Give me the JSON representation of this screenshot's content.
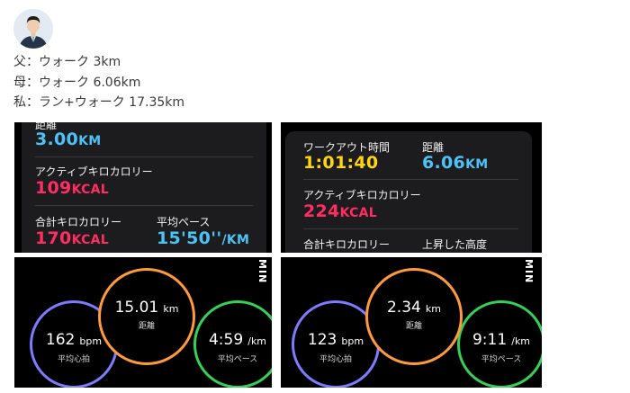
{
  "post": {
    "lines": [
      "父：ウォーク 3km",
      "母：ウォーク 6.06km",
      "私：ラン+ウォーク 17.35km"
    ]
  },
  "panel1": {
    "distance_label": "距離",
    "distance_value": "3.00",
    "distance_unit": "KM",
    "active_cal_label": "アクティブキロカロリー",
    "active_cal_value": "109",
    "active_cal_unit": "KCAL",
    "total_cal_label": "合計キロカロリー",
    "total_cal_value": "170",
    "total_cal_unit": "KCAL",
    "pace_label": "平均ペース",
    "pace_value": "15'50''",
    "pace_unit": "/KM"
  },
  "panel2": {
    "workout_time_label": "ワークアウト時間",
    "workout_time_value": "1:01:40",
    "distance_label": "距離",
    "distance_value": "6.06",
    "distance_unit": "KM",
    "active_cal_label": "アクティブキロカロリー",
    "active_cal_value": "224",
    "active_cal_unit": "KCAL",
    "total_cal_label": "合計キロカロリー",
    "elevation_label": "上昇した高度"
  },
  "panel3": {
    "tag": "MIN",
    "hr_value": "162",
    "hr_unit": "bpm",
    "hr_label": "平均心拍",
    "dist_value": "15.01",
    "dist_unit": "km",
    "dist_label": "距離",
    "pace_value": "4:59",
    "pace_unit": "/km",
    "pace_label": "平均ペース"
  },
  "panel4": {
    "tag": "MIN",
    "hr_value": "123",
    "hr_unit": "bpm",
    "hr_label": "平均心拍",
    "dist_value": "2.34",
    "dist_unit": "km",
    "dist_label": "距離",
    "pace_value": "9:11",
    "pace_unit": "/km",
    "pace_label": "平均ペース"
  },
  "colors": {
    "ring_heart": "#7b7cff",
    "ring_distance": "#ff9a3c",
    "ring_pace": "#34d058",
    "value_blue": "#4cc3f6",
    "value_pink": "#ff2d62",
    "value_yellow": "#ffd60a"
  }
}
